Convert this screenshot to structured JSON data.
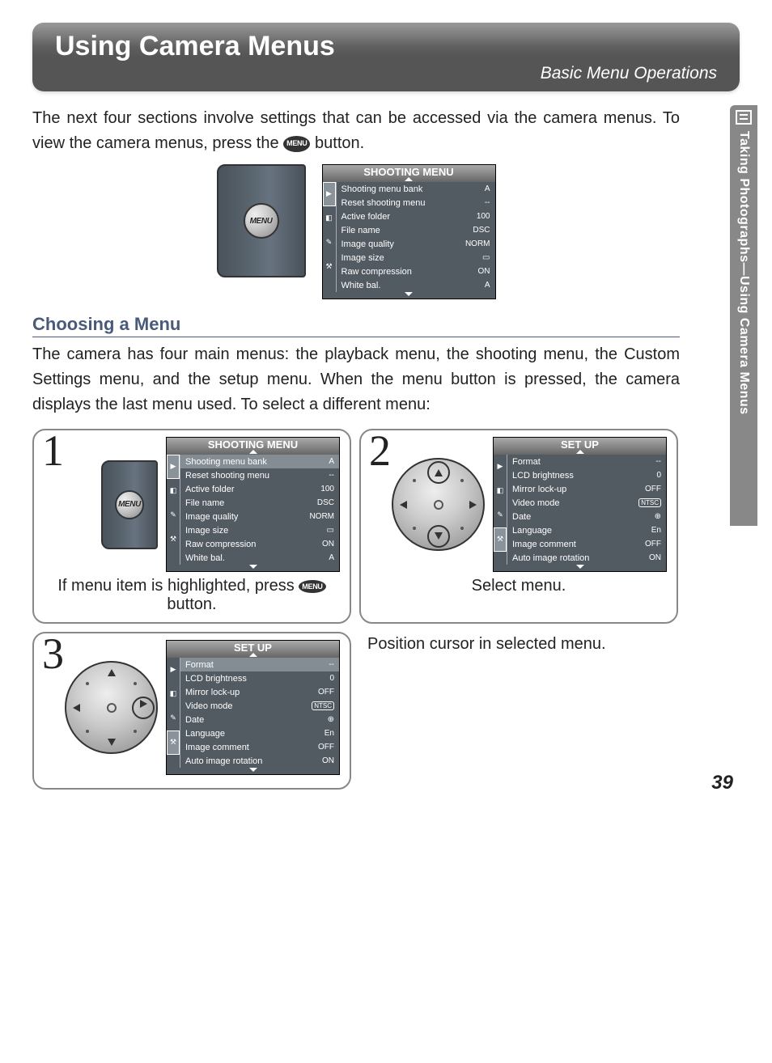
{
  "header": {
    "title": "Using Camera Menus",
    "subtitle": "Basic Menu Operations"
  },
  "intro": {
    "pre": "The next four sections involve settings that can be accessed via the camera menus.  To view the camera menus, press the ",
    "badge": "MENU",
    "post": " button."
  },
  "section_h": "Choosing a Menu",
  "section_p": "The camera has four main menus: the playback menu, the shooting menu, the Custom Settings menu, and the setup menu.  When the menu button is pressed, the camera displays the last menu used.  To select a different menu:",
  "menu_button_label": "MENU",
  "shooting_menu": {
    "title": "SHOOTING MENU",
    "items": [
      {
        "label": "Shooting menu bank",
        "value": "A"
      },
      {
        "label": "Reset shooting menu",
        "value": "--"
      },
      {
        "label": "Active folder",
        "value": "100"
      },
      {
        "label": "File name",
        "value": "DSC"
      },
      {
        "label": "Image quality",
        "value": "NORM"
      },
      {
        "label": "Image size",
        "value": "▭"
      },
      {
        "label": "Raw compression",
        "value": "ON"
      },
      {
        "label": "White bal.",
        "value": "A"
      }
    ]
  },
  "setup_menu": {
    "title": "SET UP",
    "items": [
      {
        "label": "Format",
        "value": "--"
      },
      {
        "label": "LCD brightness",
        "value": "0"
      },
      {
        "label": "Mirror lock-up",
        "value": "OFF"
      },
      {
        "label": "Video mode",
        "value": "NTSC",
        "ntsc": true
      },
      {
        "label": "Date",
        "value": "⊕"
      },
      {
        "label": "Language",
        "value": "En"
      },
      {
        "label": "Image comment",
        "value": "OFF"
      },
      {
        "label": "Auto image rotation",
        "value": "ON"
      }
    ]
  },
  "steps": {
    "1": {
      "num": "1",
      "caption_pre": "If menu item is highlighted, press ",
      "caption_post": " button."
    },
    "2": {
      "num": "2",
      "caption": "Select menu."
    },
    "3": {
      "num": "3",
      "caption": "Position cursor in selected menu."
    }
  },
  "sidetab": "Taking Photographs—Using Camera Menus",
  "page_number": "39"
}
